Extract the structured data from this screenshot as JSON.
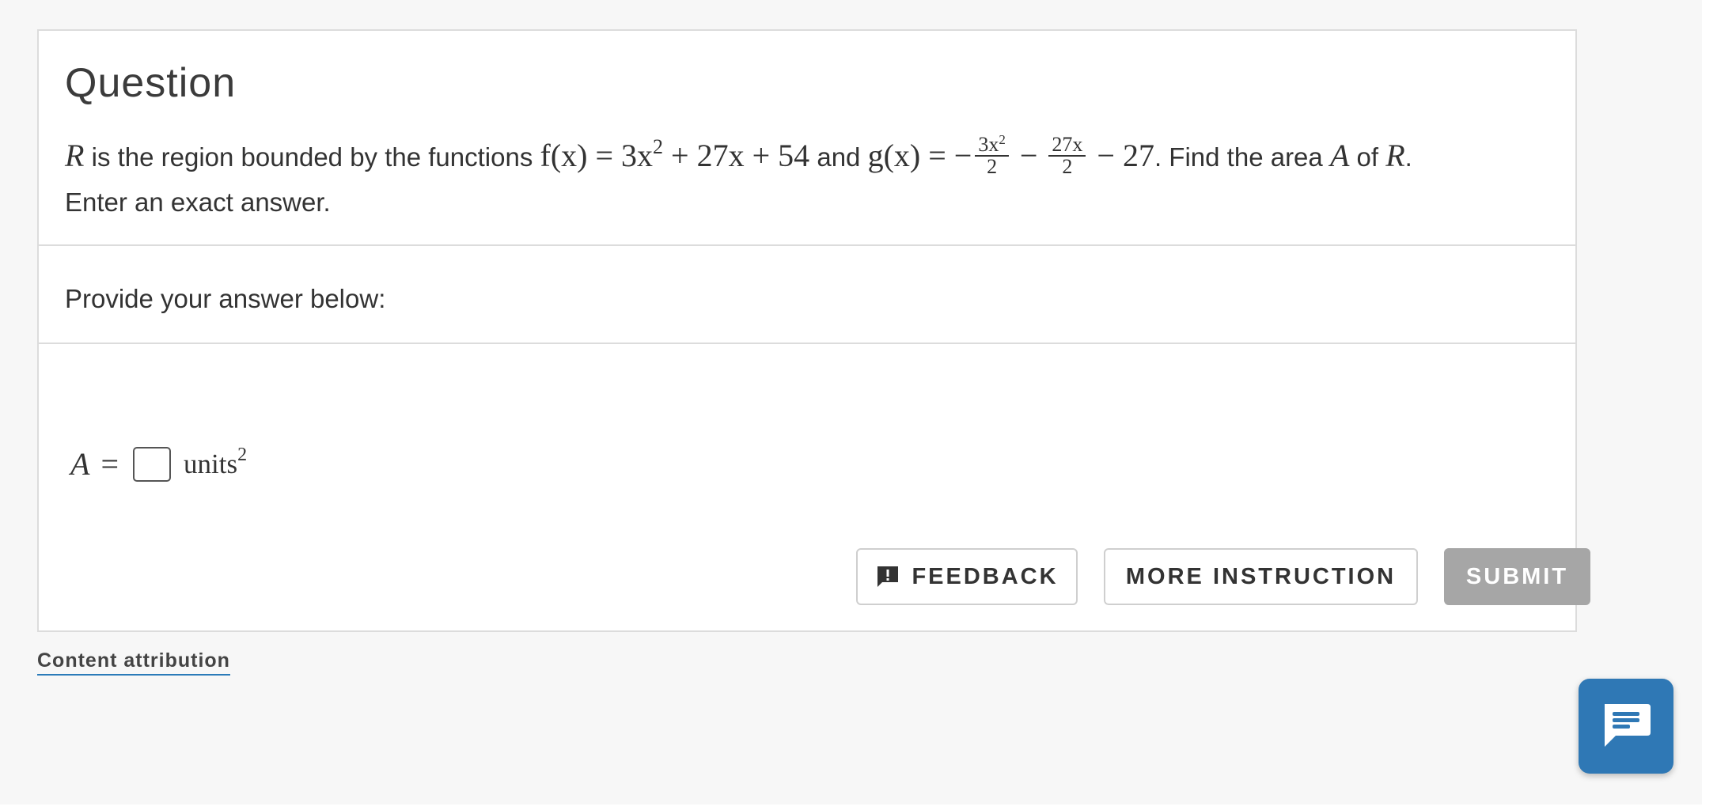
{
  "question": {
    "title": "Question",
    "text_parts": {
      "r_var": "R",
      "intro": " is the region bounded by the functions ",
      "f_def": "f(x) = 3x",
      "f_exp": "2",
      "f_rest": " + 27x + 54",
      "and": " and ",
      "g_def": "g(x) = −",
      "g_frac1_num": "3x",
      "g_frac1_num_exp": "2",
      "g_frac1_den": "2",
      "minus": " − ",
      "g_frac2_num": "27x",
      "g_frac2_den": "2",
      "g_rest": " − 27",
      "find": ". Find the area ",
      "a_var": "A",
      "of": " of ",
      "r_var2": "R",
      "period": ".",
      "instruction": "Enter an exact answer."
    }
  },
  "prompt": {
    "label": "Provide your answer below:"
  },
  "answer": {
    "variable": "A",
    "equals": "=",
    "input_value": "",
    "units": "units",
    "units_exp": "2"
  },
  "buttons": {
    "feedback": "FEEDBACK",
    "more_instruction": "MORE INSTRUCTION",
    "submit": "SUBMIT"
  },
  "footer": {
    "attribution": "Content attribution"
  },
  "icons": {
    "feedback": "feedback-icon",
    "chat": "chat-icon"
  },
  "colors": {
    "accent": "#2f78b5",
    "submit_disabled": "#a6a6a6",
    "border": "#dcdcdc",
    "page_bg": "#f7f7f7"
  }
}
